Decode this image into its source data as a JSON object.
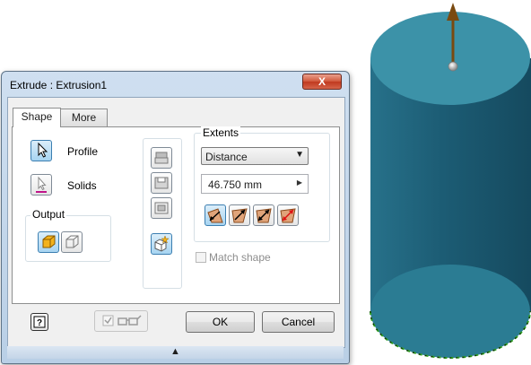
{
  "dialog": {
    "title": "Extrude : Extrusion1",
    "close_label": "X",
    "tabs": [
      {
        "label": "Shape",
        "active": true
      },
      {
        "label": "More",
        "active": false
      }
    ],
    "shape": {
      "profile_label": "Profile",
      "solids_label": "Solids",
      "output_title": "Output",
      "output_options": [
        {
          "icon": "solid-output-icon",
          "active": true
        },
        {
          "icon": "surface-output-icon",
          "active": false
        }
      ],
      "operations": [
        {
          "icon": "join-icon",
          "active": false
        },
        {
          "icon": "cut-icon",
          "active": false
        },
        {
          "icon": "intersect-icon",
          "active": false
        },
        {
          "icon": "new-solid-icon",
          "active": true
        }
      ],
      "extents_title": "Extents",
      "extents_type": "Distance",
      "distance_value": "46.750 mm",
      "directions": [
        {
          "icon": "direction-default-icon",
          "active": true
        },
        {
          "icon": "direction-flipped-icon",
          "active": false
        },
        {
          "icon": "direction-symmetric-icon",
          "active": false
        },
        {
          "icon": "direction-asymmetric-icon",
          "active": false
        }
      ],
      "match_shape_label": "Match shape",
      "match_shape_checked": false
    },
    "footer": {
      "help_icon": "help-icon",
      "preview_checked": true,
      "preview_icon": "glasses-icon",
      "ok_label": "OK",
      "cancel_label": "Cancel"
    }
  },
  "colors": {
    "cylinder_top": "#3c92a8",
    "cylinder_side": "#1c5c74",
    "cylinder_bottom": "#2b7c93",
    "manipulator_arrow": "#7a4a10",
    "profile_edge": "#2fa11f",
    "dialog_accent": "#3c7fb1"
  }
}
